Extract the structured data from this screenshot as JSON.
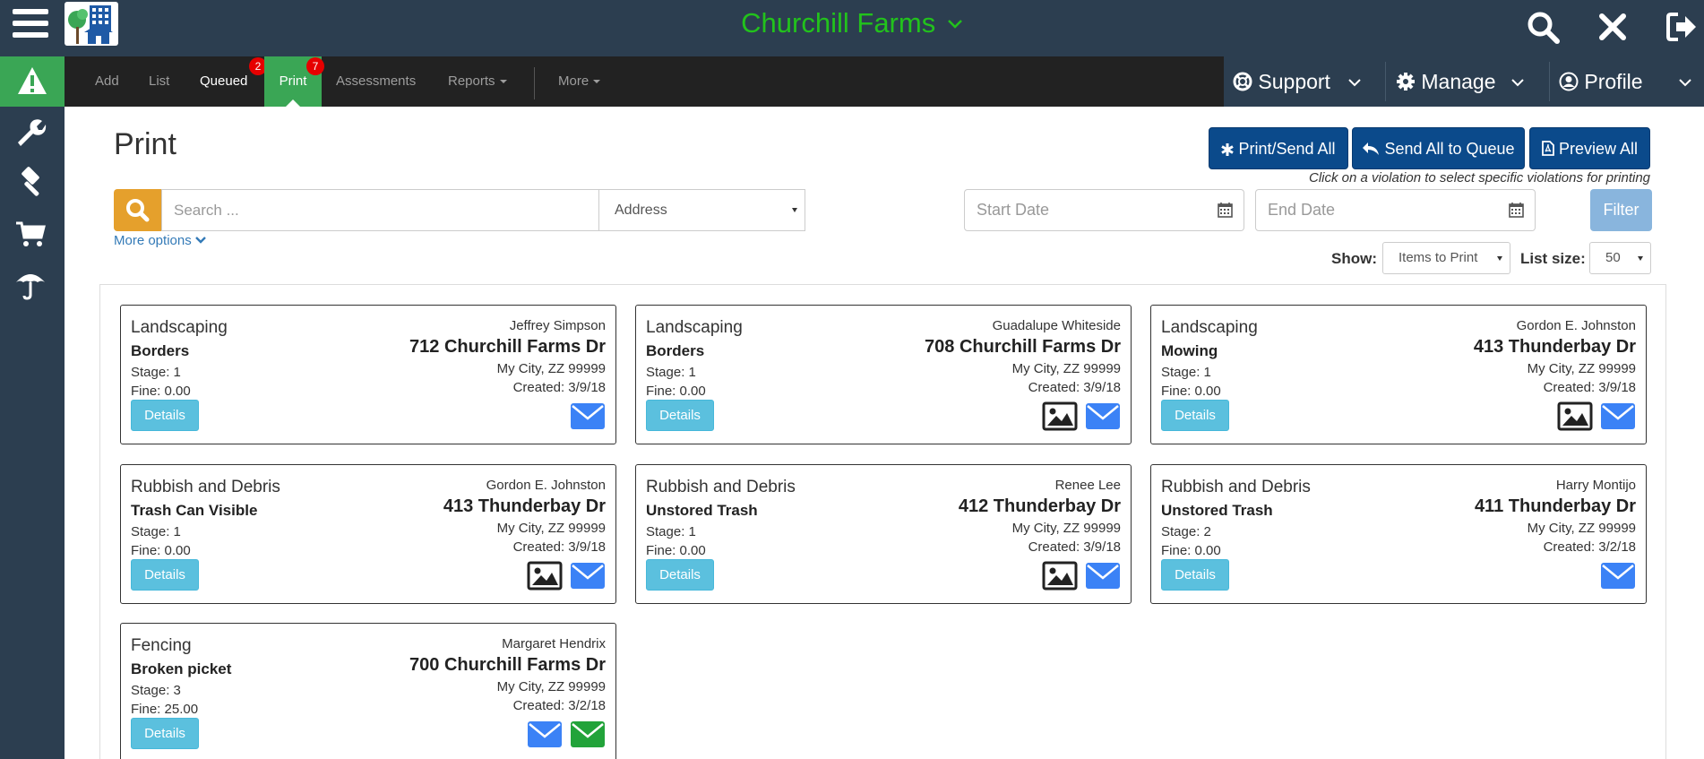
{
  "app": {
    "title": "Churchill Farms"
  },
  "nav": {
    "add": "Add",
    "list": "List",
    "queued": "Queued",
    "queued_badge": "2",
    "print": "Print",
    "print_badge": "7",
    "assessments": "Assessments",
    "reports": "Reports",
    "more": "More"
  },
  "right_nav": {
    "support": "Support",
    "manage": "Manage",
    "profile": "Profile"
  },
  "sidebar": {
    "icons": [
      "alert-icon",
      "wrench-icon",
      "gavel-icon",
      "cart-icon",
      "umbrella-icon"
    ]
  },
  "page": {
    "title": "Print",
    "print_send_all": "Print/Send All",
    "send_all_to_queue": "Send All to Queue",
    "preview_all": "Preview All",
    "hint": "Click on a violation to select specific violations for printing"
  },
  "filters": {
    "search_placeholder": "Search ...",
    "search_by": "Address",
    "start_date_placeholder": "Start Date",
    "end_date_placeholder": "End Date",
    "filter_label": "Filter",
    "more_options": "More options",
    "show_label": "Show:",
    "show_value": "Items to Print",
    "list_size_label": "List size:",
    "list_size_value": "50"
  },
  "cards": [
    {
      "category": "Landscaping",
      "violation": "Borders",
      "stage": "Stage: 1",
      "fine": "Fine: 0.00",
      "owner": "Jeffrey Simpson",
      "address": "712 Churchill Farms Dr",
      "city": "My City, ZZ 99999",
      "created": "Created: 3/9/18",
      "details": "Details",
      "icons": [
        "email-icon"
      ]
    },
    {
      "category": "Landscaping",
      "violation": "Borders",
      "stage": "Stage: 1",
      "fine": "Fine: 0.00",
      "owner": "Guadalupe Whiteside",
      "address": "708 Churchill Farms Dr",
      "city": "My City, ZZ 99999",
      "created": "Created: 3/9/18",
      "details": "Details",
      "icons": [
        "image-icon",
        "email-icon"
      ]
    },
    {
      "category": "Landscaping",
      "violation": "Mowing",
      "stage": "Stage: 1",
      "fine": "Fine: 0.00",
      "owner": "Gordon E. Johnston",
      "address": "413 Thunderbay Dr",
      "city": "My City, ZZ 99999",
      "created": "Created: 3/9/18",
      "details": "Details",
      "icons": [
        "image-icon",
        "email-icon"
      ]
    },
    {
      "category": "Rubbish and Debris",
      "violation": "Trash Can Visible",
      "stage": "Stage: 1",
      "fine": "Fine: 0.00",
      "owner": "Gordon E. Johnston",
      "address": "413 Thunderbay Dr",
      "city": "My City, ZZ 99999",
      "created": "Created: 3/9/18",
      "details": "Details",
      "icons": [
        "image-icon",
        "email-icon"
      ]
    },
    {
      "category": "Rubbish and Debris",
      "violation": "Unstored Trash",
      "stage": "Stage: 1",
      "fine": "Fine: 0.00",
      "owner": "Renee Lee",
      "address": "412 Thunderbay Dr",
      "city": "My City, ZZ 99999",
      "created": "Created: 3/9/18",
      "details": "Details",
      "icons": [
        "image-icon",
        "email-icon"
      ]
    },
    {
      "category": "Rubbish and Debris",
      "violation": "Unstored Trash",
      "stage": "Stage: 2",
      "fine": "Fine: 0.00",
      "owner": "Harry Montijo",
      "address": "411 Thunderbay Dr",
      "city": "My City, ZZ 99999",
      "created": "Created: 3/2/18",
      "details": "Details",
      "icons": [
        "email-icon"
      ]
    },
    {
      "category": "Fencing",
      "violation": "Broken picket",
      "stage": "Stage: 3",
      "fine": "Fine: 25.00",
      "owner": "Margaret Hendrix",
      "address": "700 Churchill Farms Dr",
      "city": "My City, ZZ 99999",
      "created": "Created: 3/2/18",
      "details": "Details",
      "icons": [
        "email-icon",
        "email-green-icon"
      ]
    }
  ],
  "colors": {
    "header_bg": "#2c3e50",
    "nav_bg": "#222222",
    "accent_green": "#3aa655",
    "title_green": "#22c21c",
    "primary_blue": "#0b4a8b",
    "info_blue": "#5bc0de",
    "search_orange": "#e5a02c",
    "email_blue": "#3b82f6",
    "email_green": "#22a33a"
  }
}
